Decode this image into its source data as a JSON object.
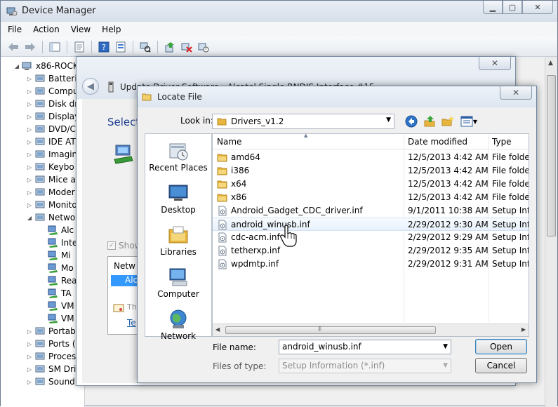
{
  "device_manager": {
    "title": "Device Manager",
    "menu": [
      "File",
      "Action",
      "View",
      "Help"
    ],
    "tree": {
      "root": "x86-ROCK",
      "items": [
        "Batteri",
        "Compu",
        "Disk dr",
        "Display",
        "DVD/C",
        "IDE AT",
        "Imagin",
        "Keybo",
        "Mice a",
        "Moder",
        "Monito",
        "Netwo"
      ],
      "network_children": [
        "Alc",
        "Inte",
        "Mi",
        "Mo",
        "Rea",
        "TA",
        "VM",
        "VM"
      ],
      "after": [
        "Portab",
        "Ports (",
        "Proces",
        "SM Dri",
        "Sound, video and game"
      ]
    }
  },
  "wizard": {
    "title": "Update Driver Software - Alcatel Single RNDIS Interface #15",
    "heading": "Select",
    "show_label": "Show",
    "list_header": "Netw",
    "list_selected": "Alc",
    "note_text": "Th",
    "link_text": "Te"
  },
  "locate_file": {
    "title": "Locate File",
    "look_in_label": "Look in:",
    "look_in_value": "Drivers_v1.2",
    "places": [
      "Recent Places",
      "Desktop",
      "Libraries",
      "Computer",
      "Network"
    ],
    "columns": [
      "Name",
      "Date modified",
      "Type"
    ],
    "files": [
      {
        "name": "amd64",
        "date": "12/5/2013 4:42 AM",
        "type": "File folder",
        "kind": "folder"
      },
      {
        "name": "i386",
        "date": "12/5/2013 4:42 AM",
        "type": "File folder",
        "kind": "folder"
      },
      {
        "name": "x64",
        "date": "12/5/2013 4:42 AM",
        "type": "File folder",
        "kind": "folder"
      },
      {
        "name": "x86",
        "date": "12/5/2013 4:42 AM",
        "type": "File folder",
        "kind": "folder"
      },
      {
        "name": "Android_Gadget_CDC_driver.inf",
        "date": "9/1/2011 10:38 AM",
        "type": "Setup Infc",
        "kind": "inf"
      },
      {
        "name": "android_winusb.inf",
        "date": "2/29/2012 9:30 AM",
        "type": "Setup Infc",
        "kind": "inf"
      },
      {
        "name": "cdc-acm.inf",
        "date": "2/29/2012 9:29 AM",
        "type": "Setup Infc",
        "kind": "inf"
      },
      {
        "name": "tetherxp.inf",
        "date": "2/29/2012 9:35 AM",
        "type": "Setup Infc",
        "kind": "inf"
      },
      {
        "name": "wpdmtp.inf",
        "date": "2/29/2012 9:31 AM",
        "type": "Setup Infc",
        "kind": "inf"
      }
    ],
    "file_name_label": "File name:",
    "file_name_value": "android_winusb.inf",
    "file_type_label": "Files of type:",
    "file_type_value": "Setup Information (*.inf)",
    "open_label": "Open",
    "cancel_label": "Cancel"
  },
  "colors": {
    "selection": "#3399ff",
    "link": "#1a5da8",
    "heading": "#1f3f8f",
    "folder": "#e8b63c"
  }
}
